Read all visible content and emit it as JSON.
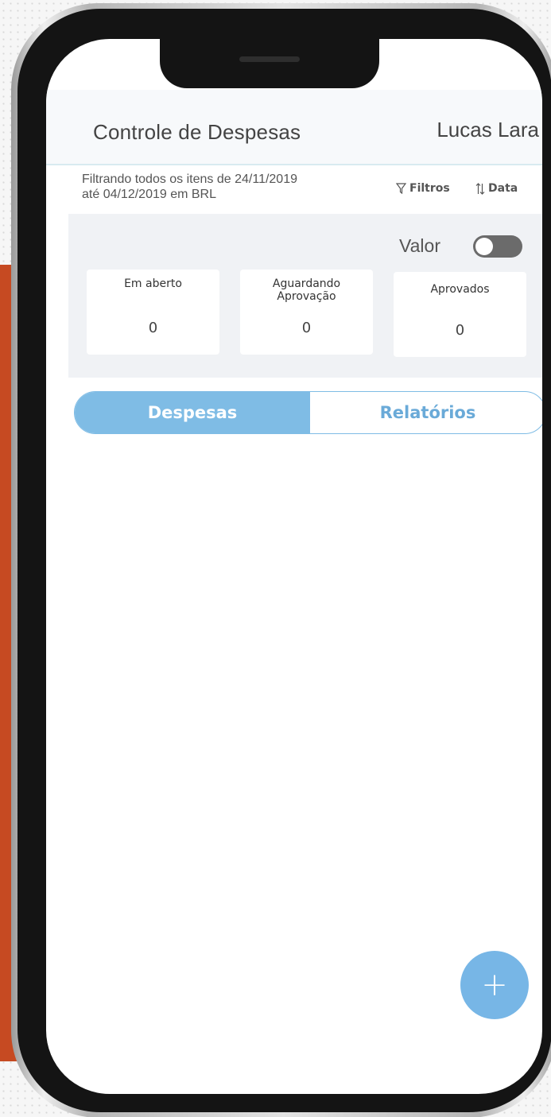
{
  "app": {
    "title": "Controle de Despesas",
    "user_name": "Lucas Lara"
  },
  "filter": {
    "line1": "Filtrando todos os itens de 24/11/2019",
    "line2": "até 04/12/2019 em BRL",
    "filters_label": "Filtros",
    "sort_label": "Data",
    "filters_icon": "funnel-icon",
    "sort_icon": "sort-arrows-icon"
  },
  "summary": {
    "toggle_label": "Valor",
    "toggle_on": false,
    "cards": [
      {
        "label_line1": "Em aberto",
        "label_line2": "",
        "value": "0"
      },
      {
        "label_line1": "Aguardando",
        "label_line2": "Aprovação",
        "value": "0"
      },
      {
        "label_line1": "Aprovados",
        "label_line2": "",
        "value": "0"
      }
    ]
  },
  "tabs": [
    {
      "label": "Despesas",
      "active": true
    },
    {
      "label": "Relatórios",
      "active": false
    }
  ],
  "fab": {
    "symbol": "+",
    "icon": "plus-icon"
  },
  "colors": {
    "accent": "#7fbce5",
    "background_accent": "#c64a22"
  }
}
